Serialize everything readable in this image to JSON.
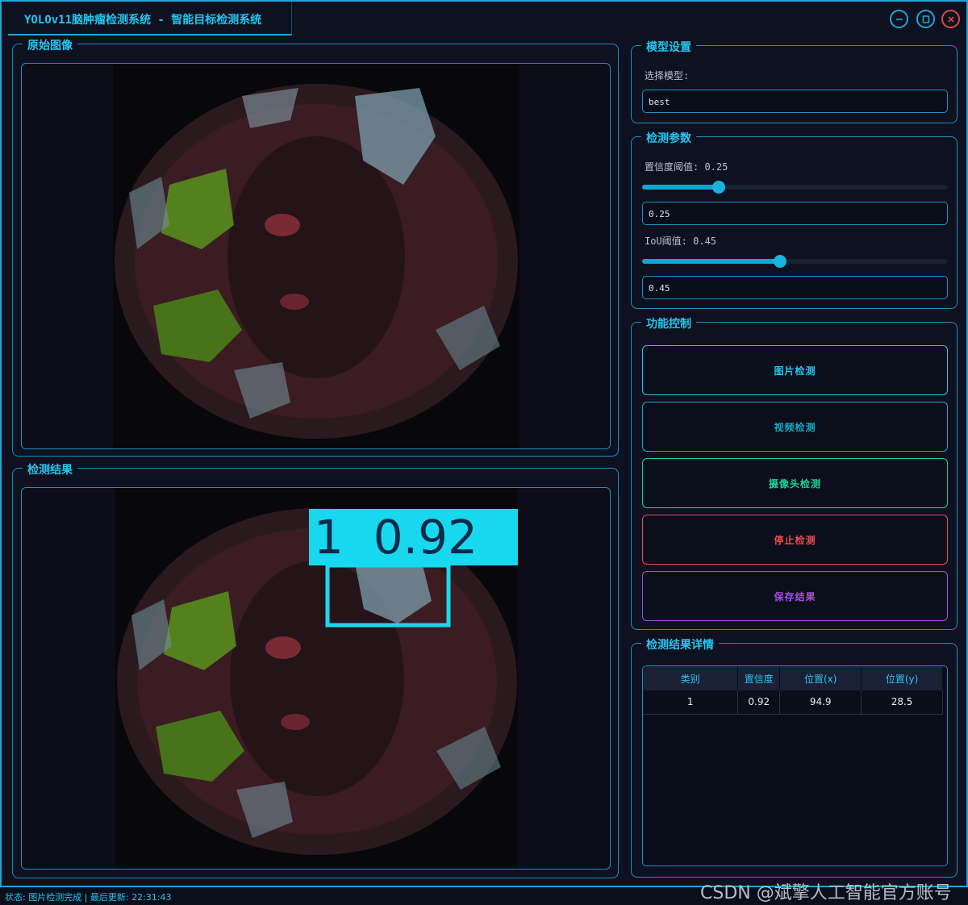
{
  "window": {
    "title": "YOLOv11脑肿瘤检测系统 - 智能目标检测系统"
  },
  "original_panel": {
    "title": "原始图像"
  },
  "result_panel": {
    "title": "检测结果",
    "detection_label": "1  0.92"
  },
  "model_settings": {
    "title": "模型设置",
    "select_label": "选择模型:",
    "selected_model": "best"
  },
  "detect_params": {
    "title": "检测参数",
    "conf_label": "置信度阈值: 0.25",
    "conf_value": "0.25",
    "conf_level": 0.25,
    "iou_label": "IoU阈值: 0.45",
    "iou_value": "0.45",
    "iou_level": 0.45
  },
  "controls": {
    "title": "功能控制",
    "buttons": [
      {
        "label": "图片检测",
        "color": "#27c5ee"
      },
      {
        "label": "视频检测",
        "color": "#18a9c9"
      },
      {
        "label": "摄像头检测",
        "color": "#19d49a"
      },
      {
        "label": "停止检测",
        "color": "#f04c4c"
      },
      {
        "label": "保存结果",
        "color": "#a64ee8"
      }
    ]
  },
  "details": {
    "title": "检测结果详情",
    "columns": [
      "类别",
      "置信度",
      "位置(x)",
      "位置(y)"
    ],
    "rows": [
      [
        "1",
        "0.92",
        "94.9",
        "28.5"
      ]
    ]
  },
  "status_bar": {
    "text": "状态: 图片检测完成 | 最后更新: 22:31:43"
  },
  "watermark": "CSDN @斌擎人工智能官方账号",
  "colors": {
    "accent": "#1fa5d6",
    "title_text": "#27c5ee",
    "background": "#0d1120",
    "detection_box": "#18d8ef"
  },
  "icons": [
    "minimize-icon",
    "maximize-icon",
    "close-icon"
  ]
}
